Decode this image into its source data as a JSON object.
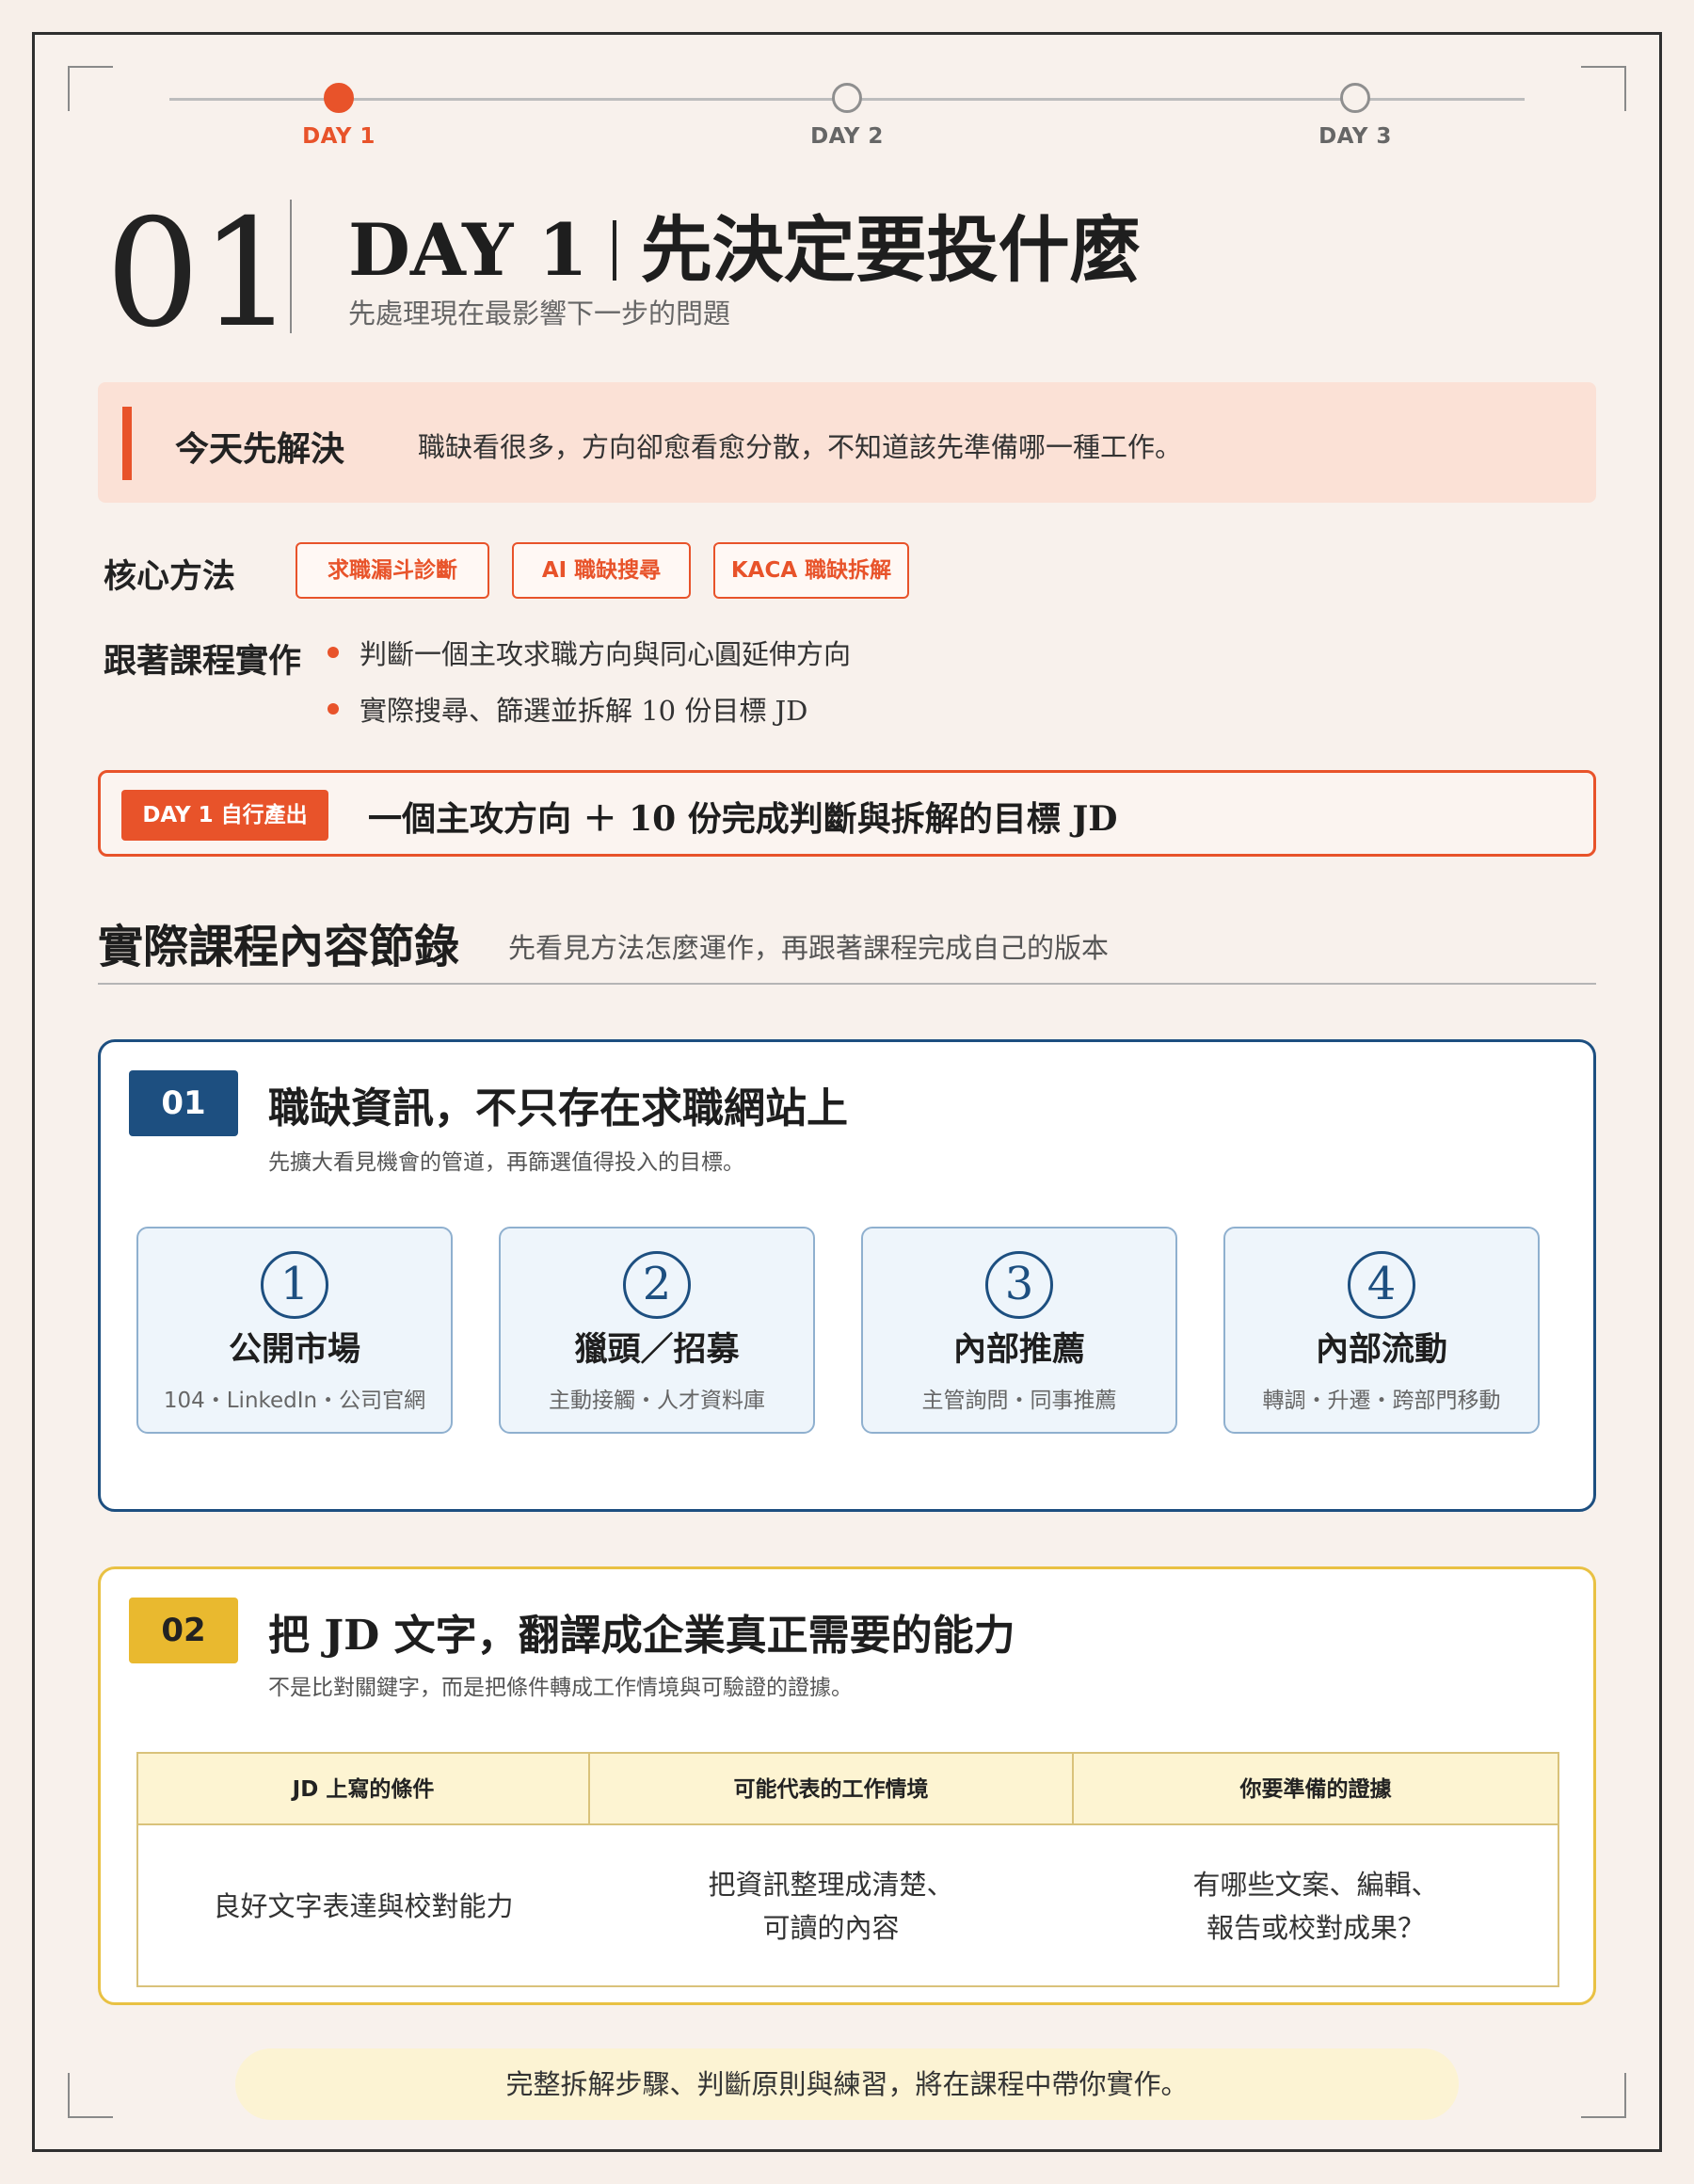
{
  "progress": {
    "steps": [
      {
        "label": "DAY 1",
        "active": true
      },
      {
        "label": "DAY 2",
        "active": false
      },
      {
        "label": "DAY 3",
        "active": false
      }
    ]
  },
  "header": {
    "number": "01",
    "title_day": "DAY 1",
    "title_text": "先決定要投什麼",
    "subtitle": "先處理現在最影響下一步的問題"
  },
  "problem": {
    "label": "今天先解決",
    "text": "職缺看很多，方向卻愈看愈分散，不知道該先準備哪一種工作。"
  },
  "methods": {
    "label": "核心方法",
    "tags": [
      "求職漏斗診斷",
      "AI 職缺搜尋",
      "KACA 職缺拆解"
    ]
  },
  "practice": {
    "label": "跟著課程實作",
    "items": [
      "判斷一個主攻求職方向與同心圓延伸方向",
      "實際搜尋、篩選並拆解 10 份目標 JD"
    ]
  },
  "output": {
    "badge": "DAY 1 自行產出",
    "text": "一個主攻方向 ＋ 10 份完成判斷與拆解的目標 JD"
  },
  "section": {
    "title": "實際課程內容節錄",
    "subtitle": "先看見方法怎麼運作，再跟著課程完成自己的版本"
  },
  "card1": {
    "number": "01",
    "title": "職缺資訊，不只存在求職網站上",
    "subtitle": "先擴大看見機會的管道，再篩選值得投入的目標。",
    "channels": [
      {
        "num": "1",
        "name": "公開市場",
        "desc": "104・LinkedIn・公司官網"
      },
      {
        "num": "2",
        "name": "獵頭／招募",
        "desc": "主動接觸・人才資料庫"
      },
      {
        "num": "3",
        "name": "內部推薦",
        "desc": "主管詢問・同事推薦"
      },
      {
        "num": "4",
        "name": "內部流動",
        "desc": "轉調・升遷・跨部門移動"
      }
    ]
  },
  "card2": {
    "number": "02",
    "title": "把 JD 文字，翻譯成企業真正需要的能力",
    "subtitle": "不是比對關鍵字，而是把條件轉成工作情境與可驗證的證據。",
    "headers": [
      "JD 上寫的條件",
      "可能代表的工作情境",
      "你要準備的證據"
    ],
    "row": [
      "良好文字表達與校對能力",
      "把資訊整理成清楚、\n可讀的內容",
      "有哪些文案、編輯、\n報告或校對成果？"
    ]
  },
  "footer": {
    "text": "完整拆解步驟、判斷原則與練習，將在課程中帶你實作。"
  },
  "colors": {
    "accent": "#e8532a",
    "navy": "#1d4f80",
    "gold": "#e9c143"
  }
}
